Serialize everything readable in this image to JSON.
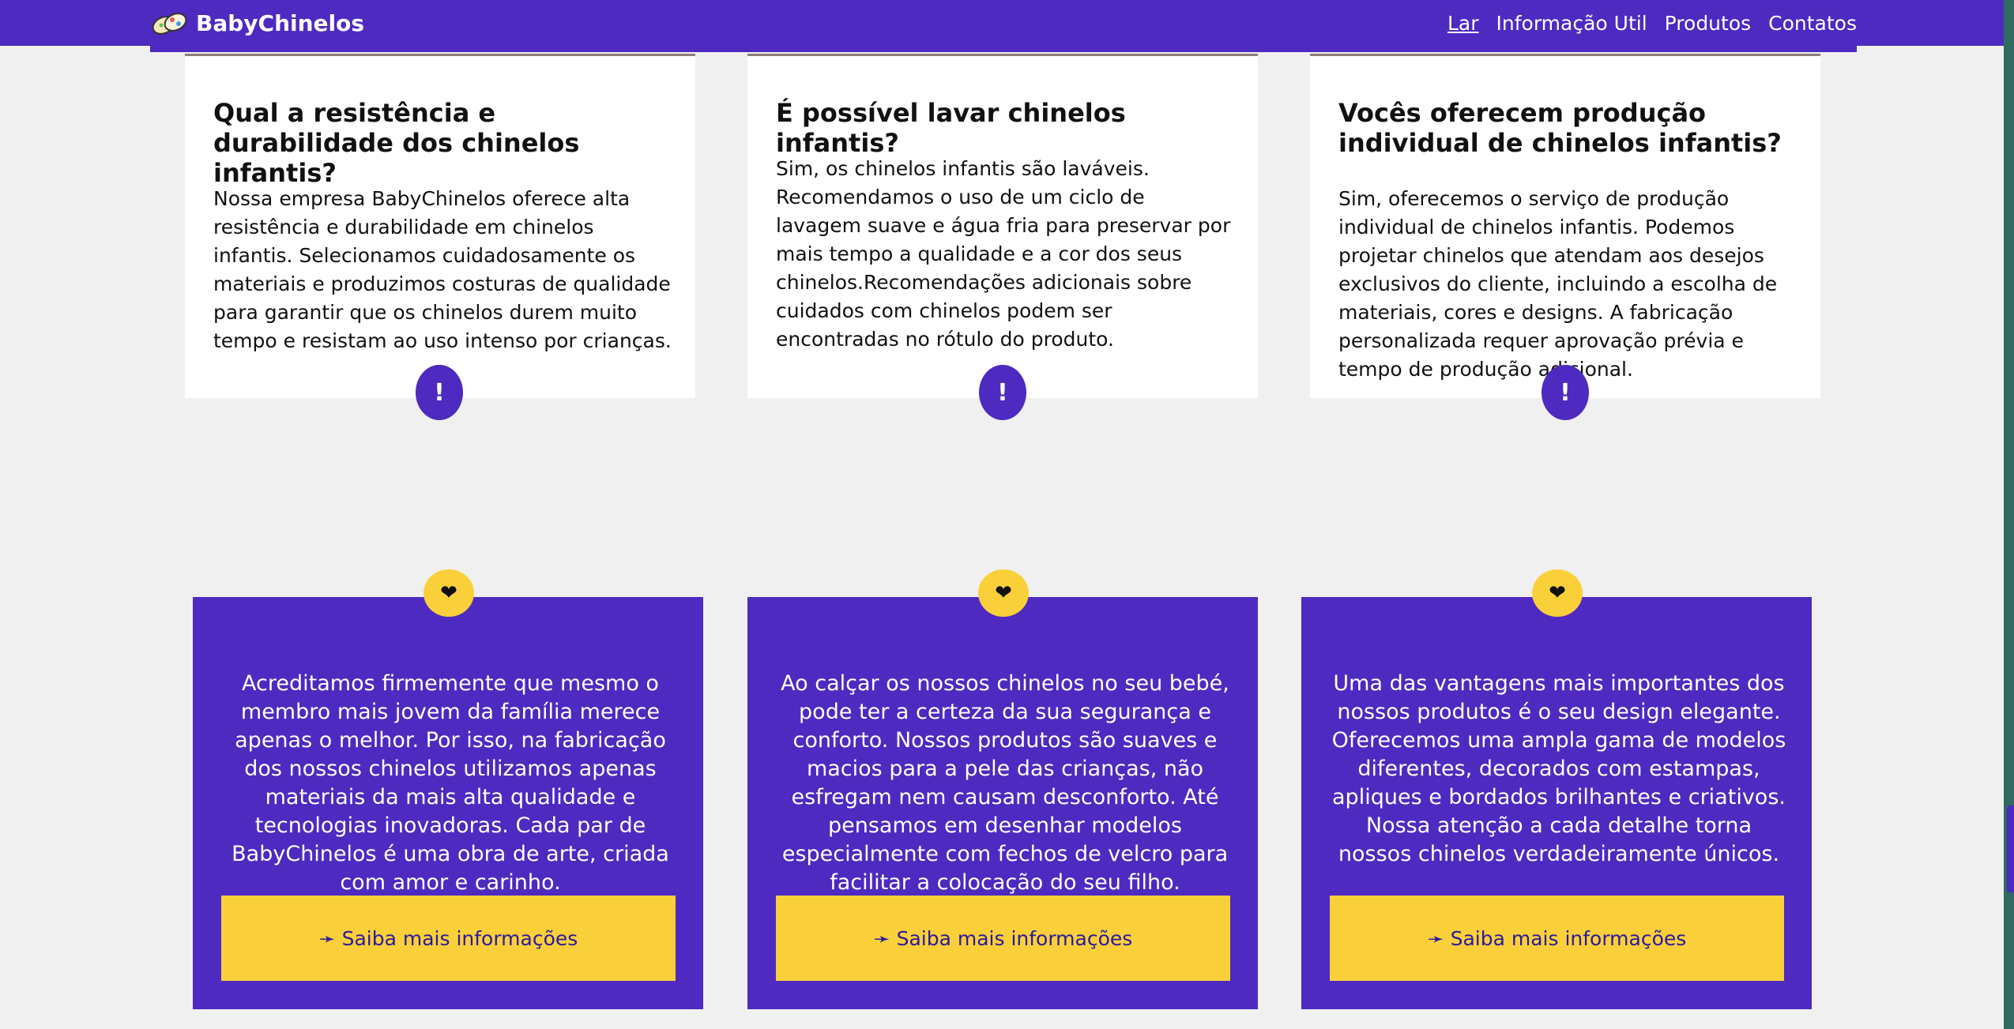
{
  "header": {
    "brand": "BabyChinelos",
    "logo_icon": "slippers-logo-icon",
    "nav": [
      {
        "label": "Lar",
        "active": true
      },
      {
        "label": "Informação Util",
        "active": false
      },
      {
        "label": "Produtos",
        "active": false
      },
      {
        "label": "Contatos",
        "active": false
      }
    ]
  },
  "faq": [
    {
      "title": "Qual a resistência e durabilidade dos chinelos infantis?",
      "text": "Nossa empresa BabyChinelos oferece alta resistência e durabilidade em chinelos infantis. Selecionamos cuidadosamente os materiais e produzimos costuras de qualidade para garantir que os chinelos durem muito tempo e resistam ao uso intenso por crianças.",
      "badge": "!"
    },
    {
      "title": "É possível lavar chinelos infantis?",
      "text": "Sim, os chinelos infantis são laváveis. Recomendamos o uso de um ciclo de lavagem suave e água fria para preservar por mais tempo a qualidade e a cor dos seus chinelos.Recomendações adicionais sobre cuidados com chinelos podem ser encontradas no rótulo do produto.",
      "badge": "!"
    },
    {
      "title": "Vocês oferecem produção individual de chinelos infantis?",
      "text": "Sim, oferecemos o serviço de produção individual de chinelos infantis. Podemos projetar chinelos que atendam aos desejos exclusivos do cliente, incluindo a escolha de materiais, cores e designs. A fabricação personalizada requer aprovação prévia e tempo de produção adicional.",
      "badge": "!"
    }
  ],
  "features": [
    {
      "icon": "❤",
      "text": "Acreditamos firmemente que mesmo o membro mais jovem da família merece apenas o melhor. Por isso, na fabricação dos nossos chinelos utilizamos apenas materiais da mais alta qualidade e tecnologias inovadoras. Cada par de BabyChinelos é uma obra de arte, criada com amor e carinho.",
      "button": "➛ Saiba mais informações"
    },
    {
      "icon": "❤",
      "text": "Ao calçar os nossos chinelos no seu bebé, pode ter a certeza da sua segurança e conforto. Nossos produtos são suaves e macios para a pele das crianças, não esfregam nem causam desconforto. Até pensamos em desenhar modelos especialmente com fechos de velcro para facilitar a colocação do seu filho.",
      "button": "➛ Saiba mais informações"
    },
    {
      "icon": "❤",
      "text": "Uma das vantagens mais importantes dos nossos produtos é o seu design elegante. Oferecemos uma ampla gama de modelos diferentes, decorados com estampas, apliques e bordados brilhantes e criativos. Nossa atenção a cada detalhe torna nossos chinelos verdadeiramente únicos.",
      "button": "➛ Saiba mais informações"
    }
  ],
  "colors": {
    "primary": "#4e2ac0",
    "accent": "#fad03a",
    "background": "#f0f0f0"
  }
}
